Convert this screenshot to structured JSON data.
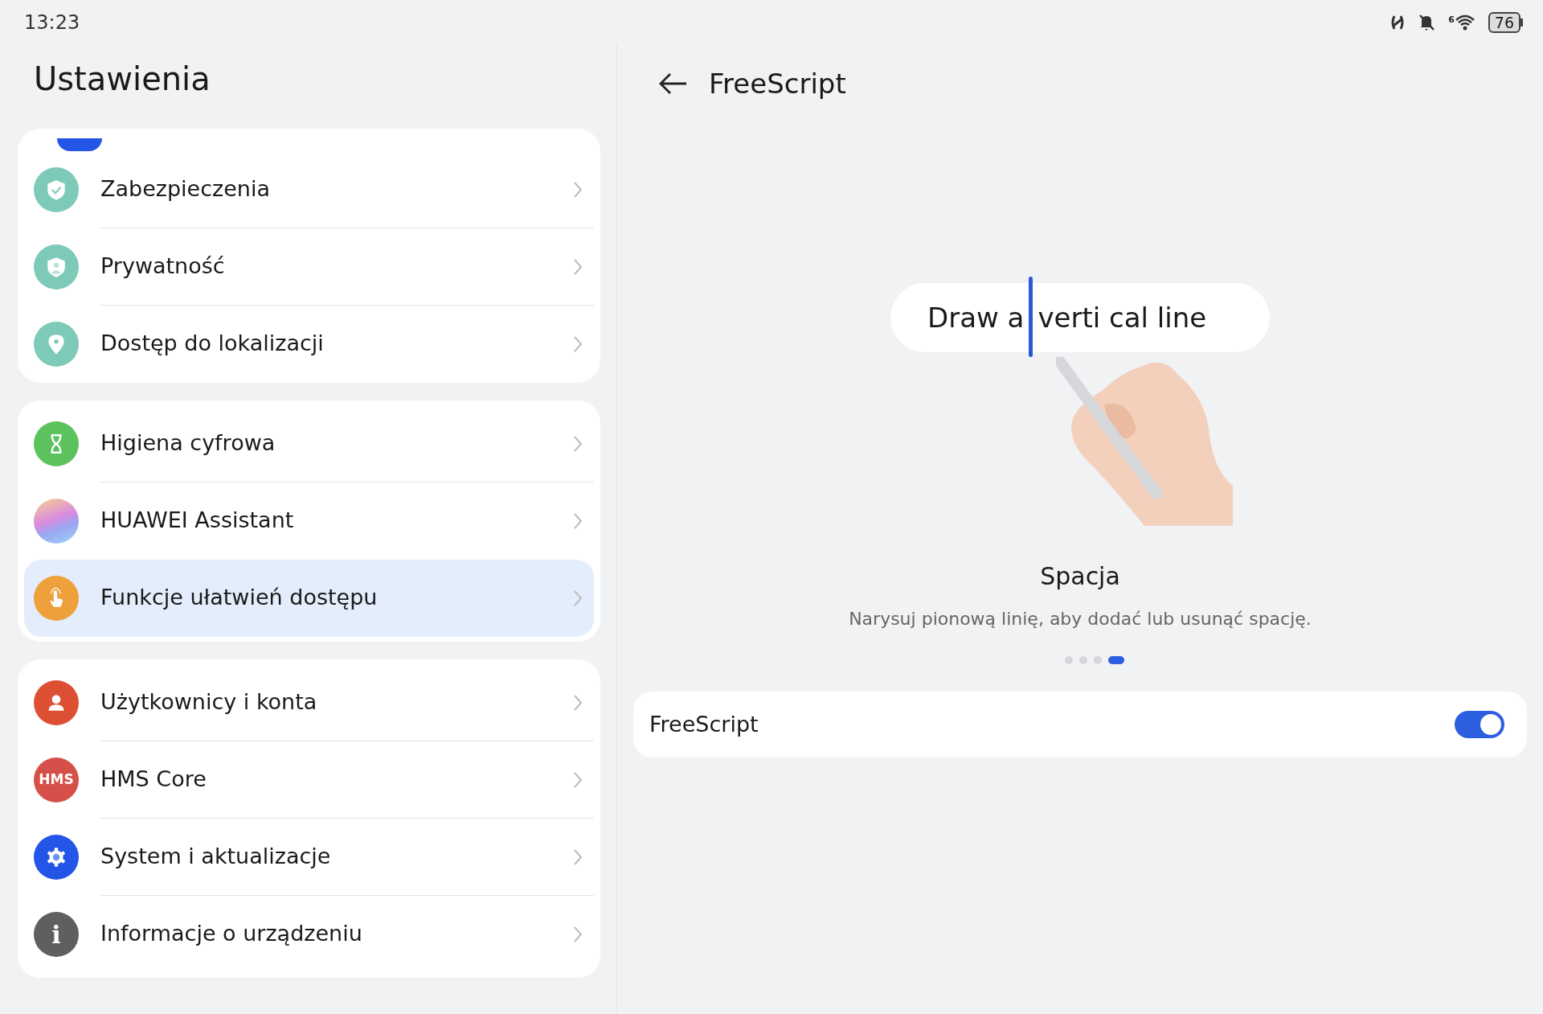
{
  "status_bar": {
    "time": "13:23",
    "wifi_label": "6",
    "battery": "76"
  },
  "sidebar": {
    "title": "Ustawienia",
    "groups": [
      {
        "items": [
          {
            "label": "Zabezpieczenia",
            "kind": "security",
            "selected": false
          },
          {
            "label": "Prywatność",
            "kind": "privacy",
            "selected": false
          },
          {
            "label": "Dostęp do lokalizacji",
            "kind": "location",
            "selected": false
          }
        ]
      },
      {
        "items": [
          {
            "label": "Higiena cyfrowa",
            "kind": "wellbeing",
            "selected": false
          },
          {
            "label": "HUAWEI Assistant",
            "kind": "assistant",
            "selected": false
          },
          {
            "label": "Funkcje ułatwień dostępu",
            "kind": "accessibility",
            "selected": true
          }
        ]
      },
      {
        "items": [
          {
            "label": "Użytkownicy i konta",
            "kind": "users",
            "selected": false
          },
          {
            "label": "HMS Core",
            "kind": "core",
            "icon_text": "HMS",
            "selected": false
          },
          {
            "label": "System i aktualizacje",
            "kind": "system",
            "selected": false
          },
          {
            "label": "Informacje o urządzeniu",
            "kind": "about",
            "icon_text": "i",
            "selected": false
          }
        ]
      }
    ]
  },
  "detail": {
    "title": "FreeScript",
    "illustration": {
      "sample_text_parts": [
        "Draw a",
        "verti cal line"
      ]
    },
    "heading": "Spacja",
    "description": "Narysuj pionową linię, aby dodać lub usunąć spację.",
    "pages": [
      {
        "selected": false
      },
      {
        "selected": false
      },
      {
        "selected": false
      },
      {
        "selected": true
      }
    ],
    "toggle_row": {
      "label": "FreeScript",
      "on": true
    }
  }
}
